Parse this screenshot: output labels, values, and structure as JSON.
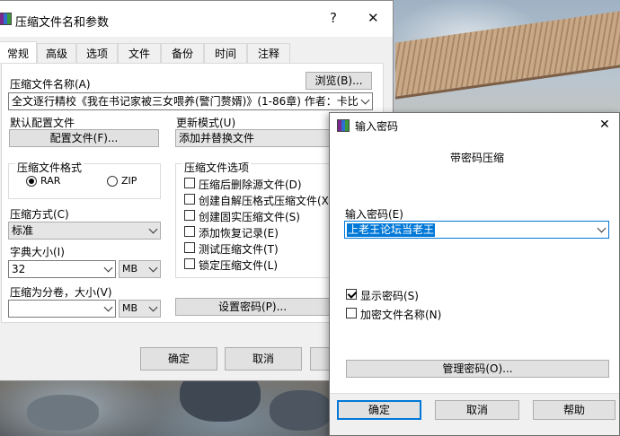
{
  "main_dialog": {
    "title": "压缩文件名和参数",
    "help_btn": "?",
    "close_btn": "✕",
    "tabs": [
      "常规",
      "高级",
      "选项",
      "文件",
      "备份",
      "时间",
      "注释"
    ],
    "archive_name_label": "压缩文件名称(A)",
    "browse_btn": "浏览(B)...",
    "archive_name_value": "全文逐行精校《我在书记家被三女喂养(警门赘婿)》(1-86章) 作者：卡比",
    "default_profile_label": "默认配置文件",
    "profile_btn": "配置文件(F)...",
    "update_mode_label": "更新模式(U)",
    "update_mode_value": "添加并替换文件",
    "format_group_label": "压缩文件格式",
    "format_options": [
      "RAR",
      "ZIP"
    ],
    "format_selected": "RAR",
    "options_group_label": "压缩文件选项",
    "options": [
      {
        "label": "压缩后删除源文件(D)",
        "checked": false
      },
      {
        "label": "创建自解压格式压缩文件(X)",
        "checked": false
      },
      {
        "label": "创建固实压缩文件(S)",
        "checked": false
      },
      {
        "label": "添加恢复记录(E)",
        "checked": false
      },
      {
        "label": "测试压缩文件(T)",
        "checked": false
      },
      {
        "label": "锁定压缩文件(L)",
        "checked": false
      }
    ],
    "method_label": "压缩方式(C)",
    "method_value": "标准",
    "dict_label": "字典大小(I)",
    "dict_value": "32",
    "dict_unit": "MB",
    "split_label": "压缩为分卷，大小(V)",
    "split_value": "",
    "split_unit": "MB",
    "set_password_btn": "设置密码(P)...",
    "ok_btn": "确定",
    "cancel_btn": "取消"
  },
  "password_dialog": {
    "title": "输入密码",
    "close_btn": "✕",
    "heading": "带密码压缩",
    "password_label": "输入密码(E)",
    "password_value": "上老王论坛当老王",
    "show_password_label": "显示密码(S)",
    "show_password_checked": true,
    "encrypt_names_label": "加密文件名称(N)",
    "encrypt_names_checked": false,
    "manage_btn": "管理密码(O)...",
    "ok_btn": "确定",
    "cancel_btn": "取消",
    "help_btn": "帮助"
  },
  "colors": {
    "accent": "#0078d7",
    "dialog_bg": "#f0f0f0",
    "button_bg": "#e1e1e1"
  }
}
